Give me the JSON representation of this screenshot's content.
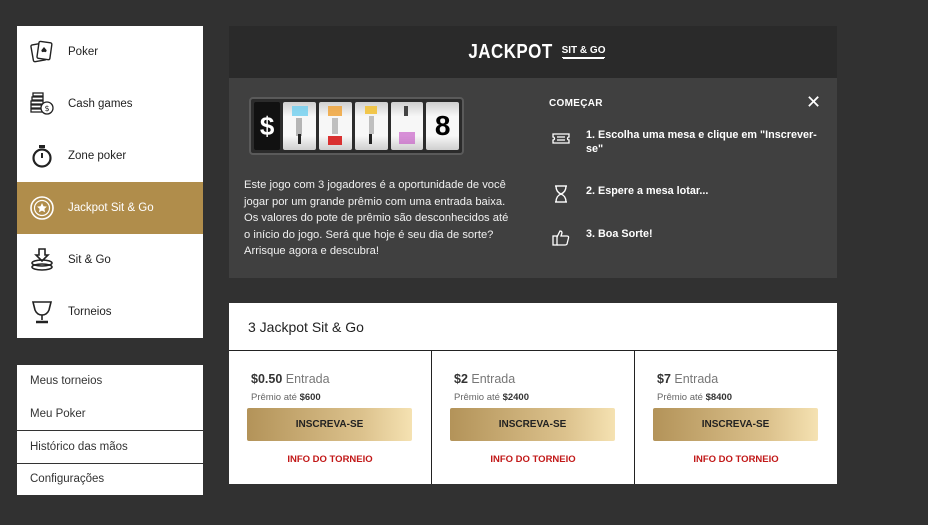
{
  "sidebar": {
    "items": [
      {
        "label": "Poker",
        "icon": "cards-icon"
      },
      {
        "label": "Cash games",
        "icon": "coins-icon"
      },
      {
        "label": "Zone poker",
        "icon": "stopwatch-icon"
      },
      {
        "label": "Jackpot Sit & Go",
        "icon": "star-chip-icon",
        "active": true
      },
      {
        "label": "Sit & Go",
        "icon": "chip-stack-icon"
      },
      {
        "label": "Torneios",
        "icon": "trophy-icon"
      }
    ]
  },
  "secondary_menu": {
    "items": [
      "Meus torneios",
      "Meu Poker",
      "Histórico das mãos",
      "Configurações"
    ]
  },
  "hero": {
    "logo_main": "JACKPOT",
    "logo_sub": "SIT & GO",
    "reel_symbol": "$",
    "reel_eight": "8",
    "description": "Este jogo com 3 jogadores é a oportunidade de você jogar por um grande prêmio com uma entrada baixa. Os valores do pote de prêmio são desconhecidos até o início do jogo. Será que hoje é seu dia de sorte? Arrisque agora e descubra!",
    "steps_title": "COMEÇAR",
    "close_glyph": "✕",
    "steps": [
      {
        "text": "1. Escolha uma mesa e clique em \"Inscrever-se\"",
        "icon": "ticket-icon"
      },
      {
        "text": "2. Espere a mesa lotar...",
        "icon": "hourglass-icon"
      },
      {
        "text": "3. Boa Sorte!",
        "icon": "thumbs-up-icon"
      }
    ]
  },
  "tournaments": {
    "title": "3 Jackpot Sit & Go",
    "cards": [
      {
        "price": "$0.50",
        "entry_label": "Entrada",
        "prize_label": "Prêmio até",
        "prize": "$600",
        "button": "INSCREVA-SE",
        "info": "INFO DO TORNEIO"
      },
      {
        "price": "$2",
        "entry_label": "Entrada",
        "prize_label": "Prêmio até",
        "prize": "$2400",
        "button": "INSCREVA-SE",
        "info": "INFO DO TORNEIO"
      },
      {
        "price": "$7",
        "entry_label": "Entrada",
        "prize_label": "Prêmio até",
        "prize": "$8400",
        "button": "INSCREVA-SE",
        "info": "INFO DO TORNEIO"
      }
    ]
  },
  "colors": {
    "background": "#313131",
    "accent_gold": "#b08d4b",
    "info_red": "#c21818",
    "panel": "#404040"
  }
}
